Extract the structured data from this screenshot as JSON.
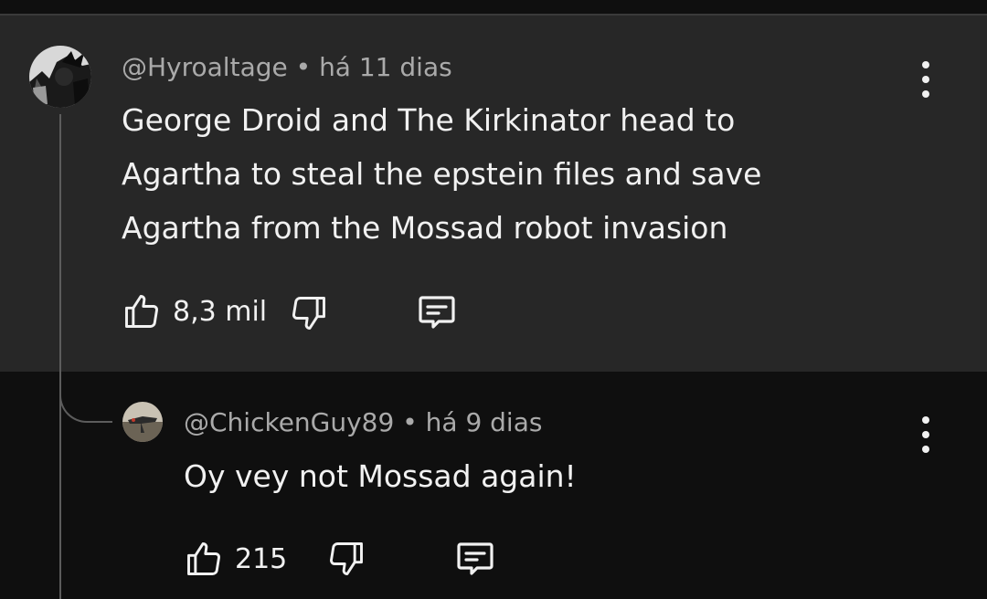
{
  "comment": {
    "author": "@Hyroaltage",
    "separator": "•",
    "time": "há 11 dias",
    "lines": [
      "George Droid and The Kirkinator head to",
      "Agartha to steal the epstein files and save",
      "Agartha from the Mossad robot invasion"
    ],
    "likes": "8,3 mil"
  },
  "reply": {
    "author": "@ChickenGuy89",
    "separator": "•",
    "time": "há 9 dias",
    "lines": [
      "Oy vey not Mossad again!"
    ],
    "likes": "215"
  },
  "icons": {
    "like": "thumbs-up-icon",
    "dislike": "thumbs-down-icon",
    "reply": "comment-icon",
    "menu": "more-vertical-icon"
  },
  "colors": {
    "comment_bg": "#272727",
    "page_bg": "#0f0f0f",
    "meta_text": "#aaaaaa",
    "body_text": "#f1f1f1",
    "thread_line": "#5c5c5c"
  }
}
